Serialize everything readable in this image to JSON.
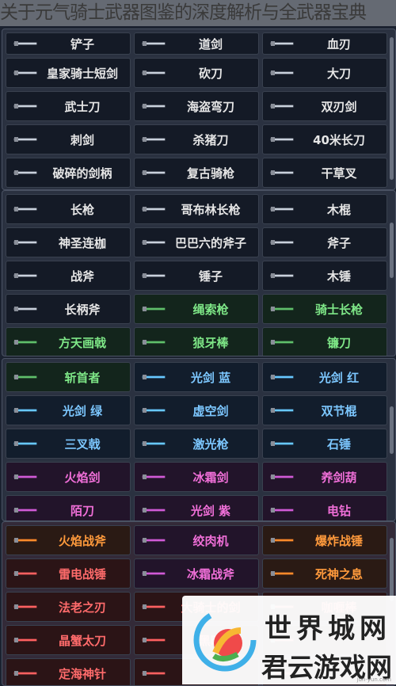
{
  "title": "关于元气骑士武器图鉴的深度解析与全武器宝典",
  "sections": [
    {
      "cells": [
        {
          "name": "铲子",
          "style": "white",
          "icon": "shovel-icon"
        },
        {
          "name": "道剑",
          "style": "white",
          "icon": "taoist-sword-icon"
        },
        {
          "name": "血刃",
          "style": "white",
          "icon": "blood-blade-icon"
        },
        {
          "name": "皇家骑士短剑",
          "style": "white",
          "icon": "short-sword-icon"
        },
        {
          "name": "砍刀",
          "style": "white",
          "icon": "machete-icon"
        },
        {
          "name": "大刀",
          "style": "white",
          "icon": "broadsword-icon"
        },
        {
          "name": "武士刀",
          "style": "white",
          "icon": "katana-icon"
        },
        {
          "name": "海盗弯刀",
          "style": "white",
          "icon": "cutlass-icon"
        },
        {
          "name": "双刃剑",
          "style": "white",
          "icon": "double-blade-icon"
        },
        {
          "name": "刺剑",
          "style": "white",
          "icon": "rapier-icon"
        },
        {
          "name": "杀猪刀",
          "style": "white",
          "icon": "butcher-knife-icon"
        },
        {
          "name": "40米长刀",
          "style": "white",
          "icon": "long-blade-icon"
        },
        {
          "name": "破碎的剑柄",
          "style": "white",
          "icon": "broken-hilt-icon"
        },
        {
          "name": "复古骑枪",
          "style": "white",
          "icon": "lance-icon"
        },
        {
          "name": "干草叉",
          "style": "white",
          "icon": "pitchfork-icon"
        }
      ]
    },
    {
      "cells": [
        {
          "name": "长枪",
          "style": "white",
          "icon": "spear-icon"
        },
        {
          "name": "哥布林长枪",
          "style": "white",
          "icon": "goblin-spear-icon"
        },
        {
          "name": "木棍",
          "style": "white",
          "icon": "stick-icon"
        },
        {
          "name": "神圣连枷",
          "style": "white",
          "icon": "flail-icon"
        },
        {
          "name": "巴巴六的斧子",
          "style": "white",
          "icon": "axe-icon"
        },
        {
          "name": "斧子",
          "style": "white",
          "icon": "axe-icon"
        },
        {
          "name": "战斧",
          "style": "white",
          "icon": "battle-axe-icon"
        },
        {
          "name": "锤子",
          "style": "white",
          "icon": "hammer-icon"
        },
        {
          "name": "木锤",
          "style": "white",
          "icon": "mallet-icon"
        },
        {
          "name": "长柄斧",
          "style": "white",
          "icon": "halberd-icon"
        },
        {
          "name": "绳索枪",
          "style": "green",
          "icon": "rope-spear-icon"
        },
        {
          "name": "骑士长枪",
          "style": "green",
          "icon": "knight-lance-icon"
        },
        {
          "name": "方天画戟",
          "style": "green",
          "icon": "halberd-icon"
        },
        {
          "name": "狼牙棒",
          "style": "green",
          "icon": "mace-icon"
        },
        {
          "name": "镰刀",
          "style": "green",
          "icon": "scythe-icon"
        }
      ]
    },
    {
      "cells": [
        {
          "name": "斩首者",
          "style": "green",
          "icon": "executioner-icon"
        },
        {
          "name": "光剑 蓝",
          "style": "blue",
          "icon": "lightsaber-icon"
        },
        {
          "name": "光剑 红",
          "style": "blue",
          "icon": "lightsaber-icon"
        },
        {
          "name": "光剑 绿",
          "style": "blue",
          "icon": "lightsaber-icon"
        },
        {
          "name": "虚空剑",
          "style": "blue",
          "icon": "void-sword-icon"
        },
        {
          "name": "双节棍",
          "style": "blue",
          "icon": "nunchaku-icon"
        },
        {
          "name": "三叉戟",
          "style": "blue",
          "icon": "trident-icon"
        },
        {
          "name": "激光枪",
          "style": "blue",
          "icon": "laser-spear-icon"
        },
        {
          "name": "石锤",
          "style": "blue",
          "icon": "stone-hammer-icon"
        },
        {
          "name": "火焰剑",
          "style": "pink",
          "icon": "flame-sword-icon"
        },
        {
          "name": "冰霜剑",
          "style": "pink",
          "icon": "frost-sword-icon"
        },
        {
          "name": "养剑葫",
          "style": "pink",
          "icon": "gourd-icon"
        },
        {
          "name": "陌刀",
          "style": "pink",
          "icon": "mo-blade-icon"
        },
        {
          "name": "光剑 紫",
          "style": "pink",
          "icon": "lightsaber-icon"
        },
        {
          "name": "电钻",
          "style": "pink",
          "icon": "drill-icon"
        }
      ]
    },
    {
      "cells": [
        {
          "name": "火焰战斧",
          "style": "orange",
          "icon": "flame-axe-icon"
        },
        {
          "name": "绞肉机",
          "style": "pink",
          "icon": "grinder-icon"
        },
        {
          "name": "爆炸战锤",
          "style": "orange",
          "icon": "explosive-hammer-icon"
        },
        {
          "name": "雷电战锤",
          "style": "red",
          "icon": "thunder-hammer-icon"
        },
        {
          "name": "冰霜战斧",
          "style": "pink",
          "icon": "frost-axe-icon"
        },
        {
          "name": "死神之息",
          "style": "orange",
          "icon": "death-breath-icon"
        },
        {
          "name": "法老之刃",
          "style": "red",
          "icon": "pharaoh-blade-icon"
        },
        {
          "name": "大骑士的剑",
          "style": "red",
          "icon": "knight-sword-icon"
        },
        {
          "name": "咖喱棒",
          "style": "red",
          "icon": "curry-stick-icon"
        },
        {
          "name": "晶蟹太刀",
          "style": "red",
          "icon": "crab-katana-icon"
        },
        {
          "name": "黑暗",
          "style": "red",
          "icon": "dark-blade-icon"
        },
        {
          "name": "",
          "style": "red",
          "icon": "blade-icon"
        },
        {
          "name": "定海神针",
          "style": "red",
          "icon": "golden-staff-icon"
        },
        {
          "name": "",
          "style": "red",
          "icon": "blade-icon"
        },
        {
          "name": "",
          "style": "red",
          "icon": "blade-icon"
        }
      ]
    }
  ],
  "watermark": {
    "top": "世界城网",
    "bottom": "君云游戏网",
    "small": "jun-yun.com"
  },
  "colors": {
    "white": "#e6e6e6",
    "green": "#7ee787",
    "blue": "#7cc7ff",
    "pink": "#f06fd8",
    "orange": "#ff9a3c",
    "red": "#ff6b6b"
  }
}
